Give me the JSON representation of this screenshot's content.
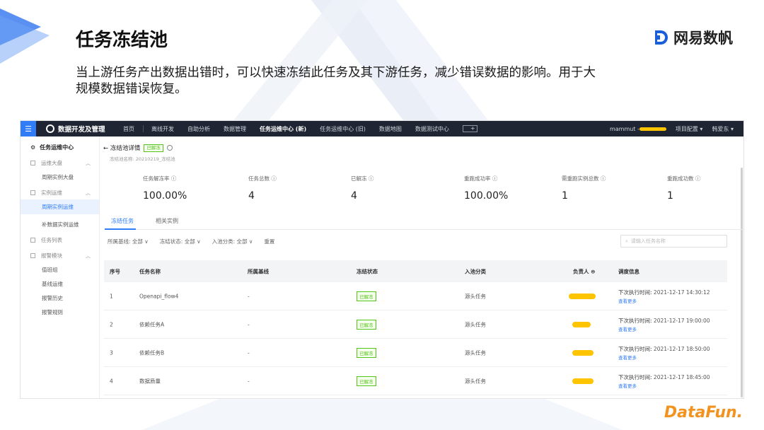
{
  "slide": {
    "title": "任务冻结池",
    "brand": "网易数帆",
    "description": "当上游任务产出数据出错时，可以快速冻结此任务及其下游任务，减少错误数据的影响。用于大规模数据错误恢复。",
    "footer_logo": "DataFun."
  },
  "app": {
    "topbar": {
      "logo": "数据开发及管理",
      "nav": [
        "首页",
        "离线开发",
        "自助分析",
        "数据管理",
        "任务运维中心 (新)",
        "任务运维中心 (旧)",
        "数据地图",
        "数据测试中心"
      ],
      "active_index": 4,
      "user": "mammut -",
      "project_config": "项目配置 ▾",
      "user_name": "韩爱东 ▾"
    },
    "sidebar": {
      "title": "任务运维中心",
      "groups": [
        {
          "label": "运维大盘",
          "items": [
            "周期实例大盘"
          ]
        },
        {
          "label": "实例运维",
          "items": [
            "周期实例运维",
            "补数据实例运维"
          ]
        },
        {
          "label": "任务列表",
          "items": []
        },
        {
          "label": "报警模块",
          "items": [
            "值班组",
            "基线运维",
            "报警历史",
            "报警规则"
          ]
        }
      ],
      "active_item": "周期实例运维"
    },
    "detail": {
      "back": "← 冻结池详情",
      "badge": "已解冻",
      "sub": "冻结池名称: 20210219_冻结池"
    },
    "stats": [
      {
        "label": "任务解冻率 ⓘ",
        "value": "100.00%"
      },
      {
        "label": "任务总数 ⓘ",
        "value": "4"
      },
      {
        "label": "已解冻 ⓘ",
        "value": "4"
      },
      {
        "label": "重跑成功率 ⓘ",
        "value": "100.00%"
      },
      {
        "label": "需重跑实例总数 ⓘ",
        "value": "1"
      },
      {
        "label": "重跑成功数 ⓘ",
        "value": "1"
      }
    ],
    "tabs": [
      "冻结任务",
      "相关实例"
    ],
    "filters": [
      "所属基线: 全部 ∨",
      "冻结状态: 全部 ∨",
      "入池分类: 全部 ∨",
      "重置"
    ],
    "search_placeholder": "请输入任务名称",
    "table": {
      "headers": [
        "序号",
        "任务名称",
        "所属基线",
        "冻结状态",
        "入池分类",
        "负责人 ⊜",
        "调度信息"
      ],
      "next_label": "下次执行时间:",
      "more_label": "查看更多",
      "rows": [
        {
          "no": "1",
          "name": "Openapi_flow4",
          "baseline": "-",
          "status": "已解冻",
          "category": "源头任务",
          "next_time": "2021-12-17 14:30:12"
        },
        {
          "no": "2",
          "name": "依赖任务A",
          "baseline": "-",
          "status": "已解冻",
          "category": "源头任务",
          "next_time": "2021-12-17 19:00:00"
        },
        {
          "no": "3",
          "name": "依赖任务B",
          "baseline": "-",
          "status": "已解冻",
          "category": "源头任务",
          "next_time": "2021-12-17 18:50:00"
        },
        {
          "no": "4",
          "name": "数据质量",
          "baseline": "-",
          "status": "已解冻",
          "category": "源头任务",
          "next_time": "2021-12-17 18:45:00"
        }
      ]
    }
  },
  "colors": {
    "accent": "#2f7cf6",
    "topbar": "#1f2532",
    "success": "#52c41a",
    "redact": "#ffc400",
    "datafun": "#f29320"
  }
}
